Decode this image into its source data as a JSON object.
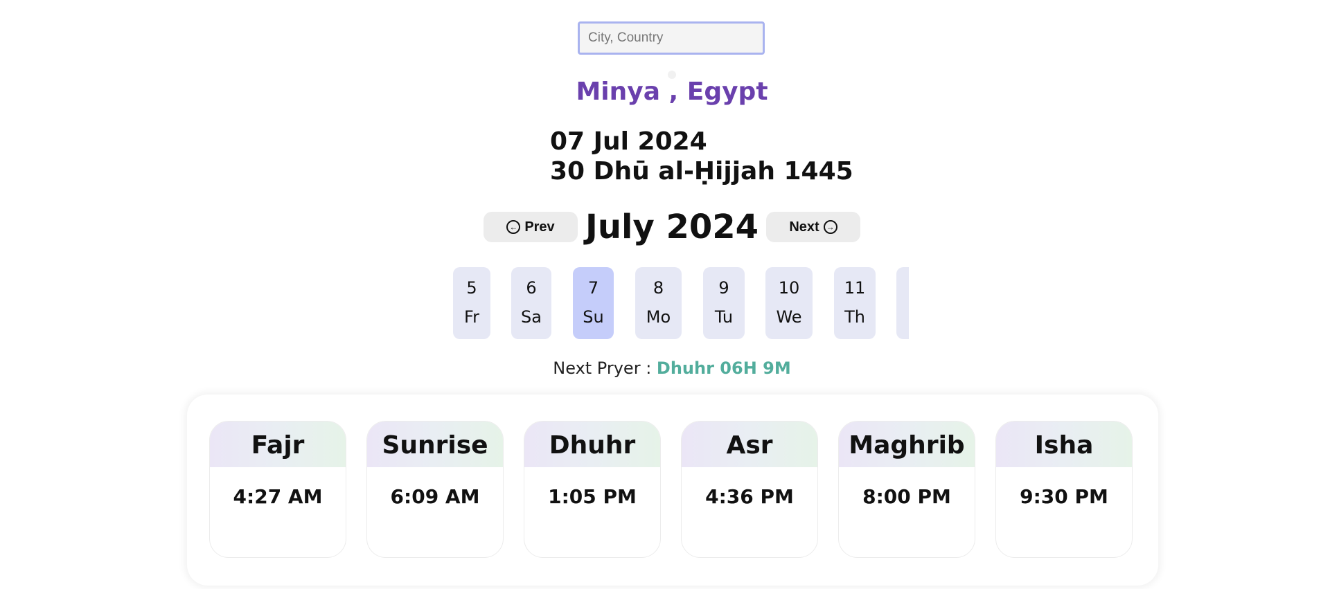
{
  "search": {
    "placeholder": "City, Country",
    "value": ""
  },
  "location": "Minya , Egypt",
  "dates": {
    "gregorian": "07 Jul 2024",
    "hijri": "30 Dhū al-Ḥijjah 1445"
  },
  "nav": {
    "prev_label": "Prev",
    "next_label": "Next",
    "month_title": "July 2024",
    "prev_icon": "arrow-circle-left-icon",
    "next_icon": "arrow-circle-right-icon"
  },
  "days": [
    {
      "num": "5",
      "dow": "Fr",
      "active": false
    },
    {
      "num": "6",
      "dow": "Sa",
      "active": false
    },
    {
      "num": "7",
      "dow": "Su",
      "active": true
    },
    {
      "num": "8",
      "dow": "Mo",
      "active": false
    },
    {
      "num": "9",
      "dow": "Tu",
      "active": false
    },
    {
      "num": "10",
      "dow": "We",
      "active": false
    },
    {
      "num": "11",
      "dow": "Th",
      "active": false
    },
    {
      "num": "",
      "dow": "",
      "active": false
    }
  ],
  "next_prayer": {
    "label": "Next Pryer :",
    "value": "Dhuhr 06H 9M"
  },
  "prayers": [
    {
      "name": "Fajr",
      "time": "4:27 AM"
    },
    {
      "name": "Sunrise",
      "time": "6:09 AM"
    },
    {
      "name": "Dhuhr",
      "time": "1:05 PM"
    },
    {
      "name": "Asr",
      "time": "4:36 PM"
    },
    {
      "name": "Maghrib",
      "time": "8:00 PM"
    },
    {
      "name": "Isha",
      "time": "9:30 PM"
    }
  ],
  "colors": {
    "accent_purple": "#6a40ad",
    "active_day": "#c5cdfa",
    "day_bg": "#e6e8f5",
    "next_prayer_value": "#52ad9c",
    "input_border": "#a9b3ef"
  }
}
